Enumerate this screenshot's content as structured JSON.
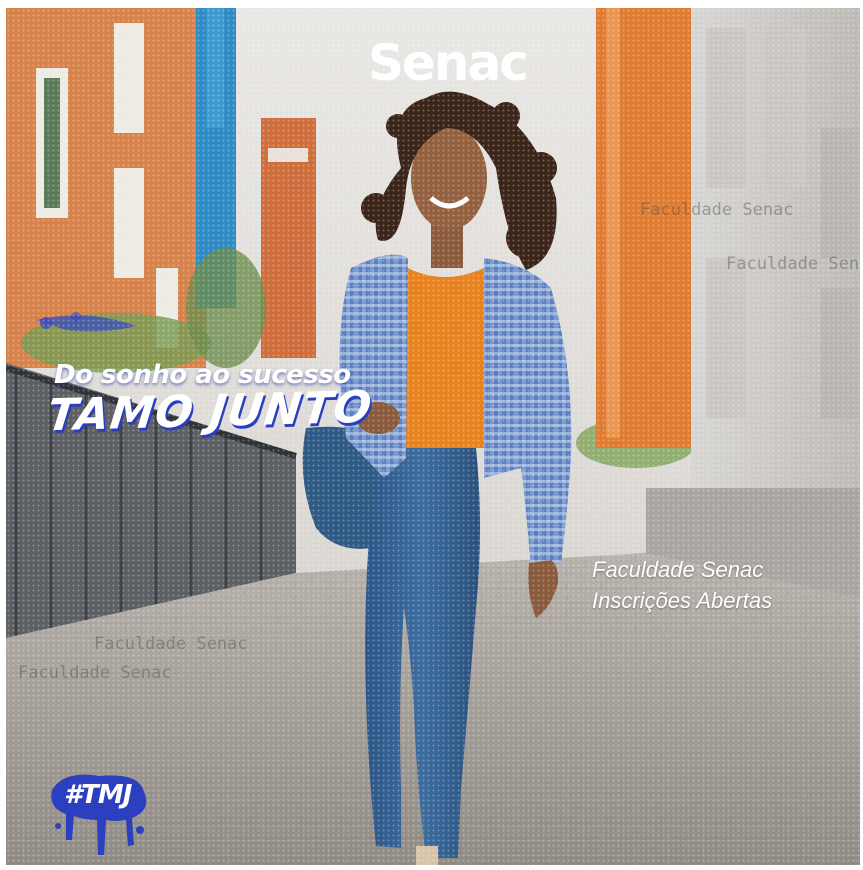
{
  "brand": {
    "logo": "Senac"
  },
  "headline": "Do sonho ao sucesso",
  "tagline": "TAMO JUNTO",
  "info": {
    "line1": "Faculdade Senac",
    "line2": "Inscrições Abertas"
  },
  "hashtag": "#TMJ",
  "stamps": [
    "Faculdade Senac",
    "Faculdade Senac",
    "Faculdade Senac",
    "Faculdade Senac"
  ],
  "colors": {
    "accent_blue": "#2a3fc0",
    "shirt_orange": "#e8821e",
    "wall_orange": "#d9773a",
    "jeans": "#2f5c8e"
  },
  "icons": [
    "backpack",
    "hashtag-paint-splash"
  ]
}
